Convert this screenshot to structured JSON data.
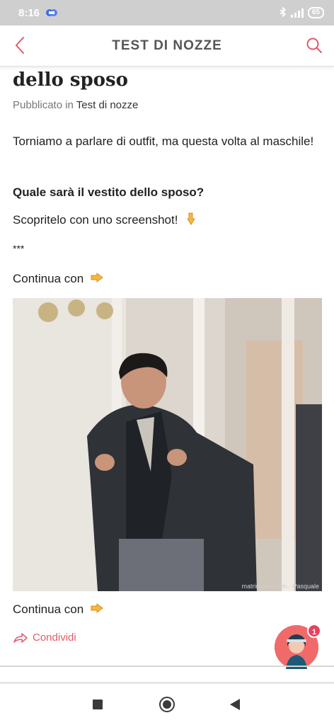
{
  "status_bar": {
    "time": "8:16",
    "battery": "65"
  },
  "header": {
    "title": "TEST DI NOZZE"
  },
  "article": {
    "title": "dello sposo",
    "meta_prefix": "Pubblicato in ",
    "meta_category": "Test di nozze",
    "paragraphs": [
      "Torniamo a parlare di outfit, ma questa volta al maschile!",
      "Quale sarà il vestito dello sposo?",
      "Scopritelo con uno screenshot!",
      "***",
      "Continua con"
    ],
    "after_image": "Continua con",
    "image_watermark": "matrimonio.com · Pasquale"
  },
  "share": {
    "label": "Condividi"
  },
  "chat": {
    "badge_count": "1"
  },
  "colors": {
    "accent": "#e05b6a",
    "status_bar": "#cfcfcf"
  }
}
